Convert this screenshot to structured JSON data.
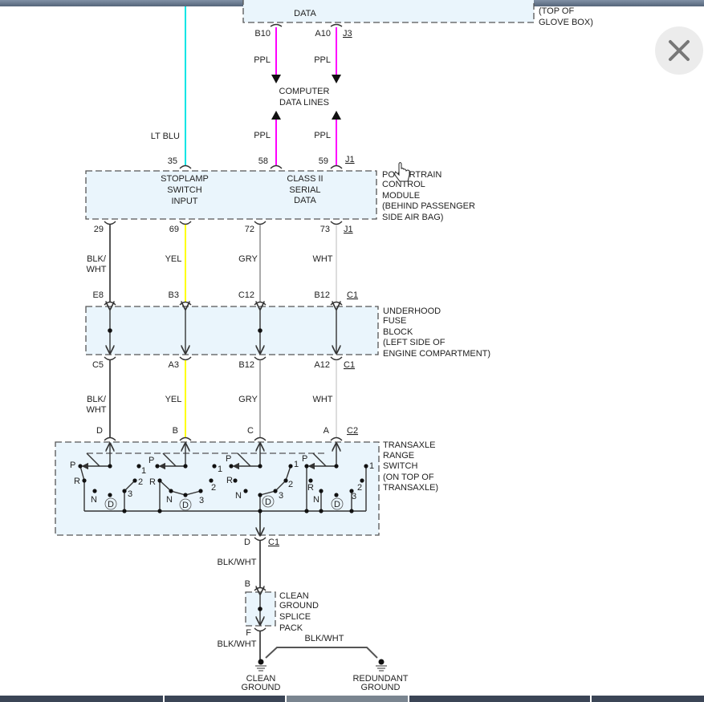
{
  "top_module": {
    "text": "DATA",
    "location": [
      "(TOP OF",
      "GLOVE BOX)"
    ]
  },
  "top_pins": {
    "left": "B10",
    "right": "A10",
    "connector": "J3"
  },
  "data_lines": {
    "wire_color": "PPL",
    "title": [
      "COMPUTER",
      "DATA LINES"
    ]
  },
  "pcm_top_pins": {
    "p35": "35",
    "p58": "58",
    "p59": "59",
    "connector": "J1",
    "lt_blu": "LT BLU"
  },
  "pcm": {
    "input_label": [
      "STOPLAMP",
      "SWITCH",
      "INPUT"
    ],
    "serial_label": [
      "CLASS II",
      "SERIAL",
      "DATA"
    ],
    "name": [
      "POWERTRAIN",
      "CONTROL",
      "MODULE",
      "(BEHIND PASSENGER",
      "SIDE AIR BAG)"
    ]
  },
  "pcm_bottom_pins": {
    "p1": "29",
    "p2": "69",
    "p3": "72",
    "p4": "73",
    "connector": "J1"
  },
  "wires_upper": {
    "w1": [
      "BLK/",
      "WHT"
    ],
    "w2": "YEL",
    "w3": "GRY",
    "w4": "WHT"
  },
  "fuse_top_pins": {
    "p1": "E8",
    "p2": "B3",
    "p3": "C12",
    "p4": "B12",
    "connector": "C1"
  },
  "fuse_block": {
    "name": [
      "UNDERHOOD",
      "FUSE",
      "BLOCK",
      "(LEFT SIDE OF",
      "ENGINE COMPARTMENT)"
    ]
  },
  "fuse_bottom_pins": {
    "p1": "C5",
    "p2": "A3",
    "p3": "B12",
    "p4": "A12",
    "connector": "C1"
  },
  "wires_lower": {
    "w1": [
      "BLK/",
      "WHT"
    ],
    "w2": "YEL",
    "w3": "GRY",
    "w4": "WHT"
  },
  "trs_pins": {
    "p1": "D",
    "p2": "B",
    "p3": "C",
    "p4": "A",
    "connector": "C2"
  },
  "trs": {
    "name": [
      "TRANSAXLE",
      "RANGE",
      "SWITCH",
      "(ON TOP OF",
      "TRANSAXLE)"
    ],
    "positions": {
      "P": "P",
      "R": "R",
      "N": "N",
      "D": "D",
      "one": "1",
      "two": "2",
      "three": "3"
    }
  },
  "trs_out": {
    "pin": "D",
    "connector": "C1",
    "wire": "BLK/WHT"
  },
  "splice": {
    "pin_in": "B",
    "pin_out": "F",
    "name": [
      "CLEAN",
      "GROUND",
      "SPLICE",
      "PACK"
    ],
    "wire_out": "BLK/WHT",
    "wire_branch": "BLK/WHT"
  },
  "grounds": {
    "clean": [
      "CLEAN",
      "GROUND"
    ],
    "redundant": [
      "REDUNDANT",
      "GROUND"
    ]
  },
  "colors": {
    "lt_blu": "#00e5e5",
    "ppl": "#ff00ff",
    "yel": "#ffff00",
    "gry": "#aaaaaa",
    "wht": "#dddddd",
    "blk_wht": "#555555",
    "module_fill": "#eaf5fc"
  },
  "icons": {
    "close": "close-icon",
    "cursor": "hand-pointer-icon"
  }
}
